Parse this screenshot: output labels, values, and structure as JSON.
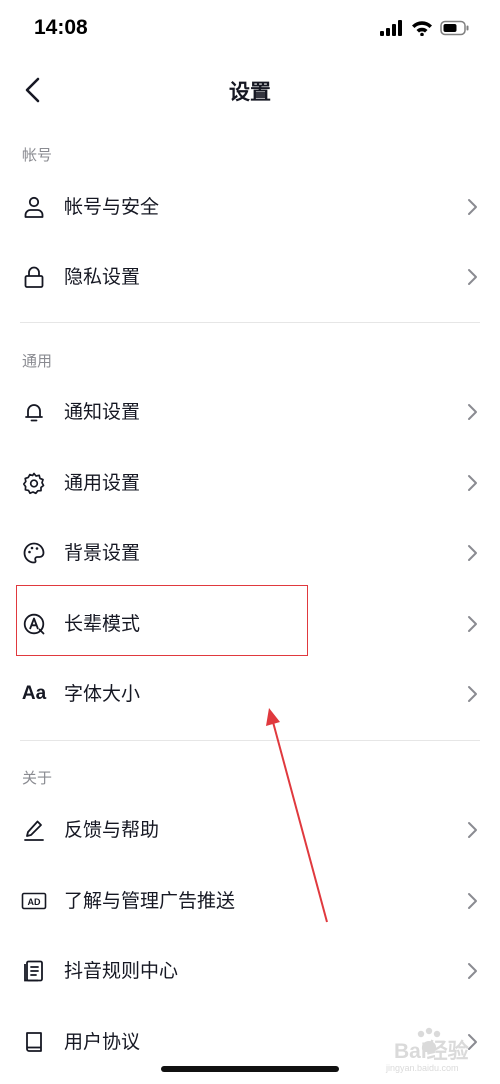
{
  "status_bar": {
    "time": "14:08"
  },
  "header": {
    "title": "设置"
  },
  "sections": {
    "account": {
      "title": "帐号",
      "items": [
        {
          "label": "帐号与安全",
          "icon": "person-icon"
        },
        {
          "label": "隐私设置",
          "icon": "lock-icon"
        }
      ]
    },
    "general": {
      "title": "通用",
      "items": [
        {
          "label": "通知设置",
          "icon": "bell-icon"
        },
        {
          "label": "通用设置",
          "icon": "gear-icon"
        },
        {
          "label": "背景设置",
          "icon": "palette-icon"
        },
        {
          "label": "长辈模式",
          "icon": "elder-mode-icon"
        },
        {
          "label": "字体大小",
          "icon": "font-size-icon",
          "icon_text": "Aa"
        }
      ]
    },
    "about": {
      "title": "关于",
      "items": [
        {
          "label": "反馈与帮助",
          "icon": "pencil-icon"
        },
        {
          "label": "了解与管理广告推送",
          "icon": "ad-icon",
          "icon_text": "AD"
        },
        {
          "label": "抖音规则中心",
          "icon": "document-icon"
        },
        {
          "label": "用户协议",
          "icon": "book-icon"
        }
      ]
    }
  },
  "annotation": {
    "highlight_color": "#e0393e"
  },
  "watermark": {
    "text": "Bai经验",
    "subtext": "jingyan.baidu.com"
  }
}
